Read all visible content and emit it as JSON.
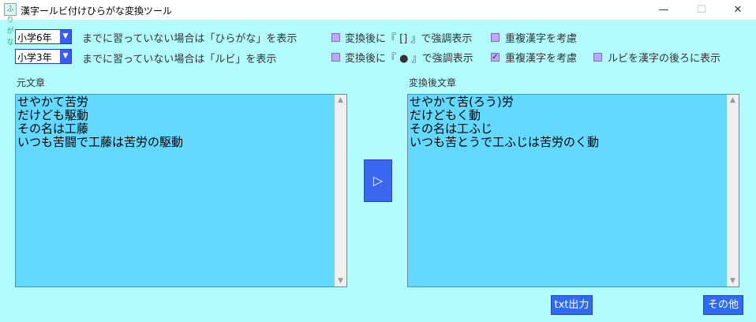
{
  "window": {
    "title": "漢字ールビ付けひらがな変換ツール",
    "icon_text": "ふりがな",
    "minimize": "—",
    "maximize": "☐",
    "close": "✕"
  },
  "options": {
    "hiragana_grade": "小学6年",
    "hiragana_text": "までに習っていない場合は「ひらがな」を表示",
    "ruby_grade": "小学3年",
    "ruby_text": "までに習っていない場合は「ルビ」を表示",
    "emphasis_bracket_label": "変換後に『 [] 』で強調表示",
    "emphasis_bracket_checked": false,
    "duplicate_kanji_1_label": "重複漢字を考慮",
    "duplicate_kanji_1_checked": false,
    "emphasis_dot_label": "変換後に『 ● 』で強調表示",
    "emphasis_dot_checked": false,
    "duplicate_kanji_2_label": "重複漢字を考慮",
    "duplicate_kanji_2_checked": true,
    "ruby_after_label": "ルビを漢字の後ろに表示",
    "ruby_after_checked": false
  },
  "source": {
    "label": "元文章",
    "text": "せやかて苦労\nだけども駆動\nその名は工藤\nいつも苦闘で工藤は苦労の駆動"
  },
  "result": {
    "label": "変換後文章",
    "text": "せやかて苦(ろう)労\nだけどもく動\nその名は工ふじ\nいつも苦とうで工ふじは苦労のく動"
  },
  "buttons": {
    "convert": "▷",
    "txt_output": "txt出力",
    "other": "その他"
  }
}
